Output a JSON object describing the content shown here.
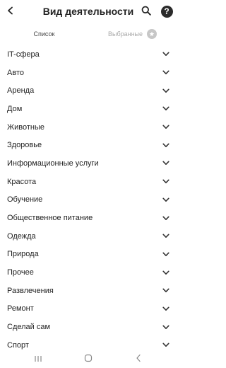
{
  "header": {
    "title": "Вид деятельности",
    "back_icon": "chevron-left-icon",
    "search_icon": "search-icon",
    "help_label": "?"
  },
  "tabs": [
    {
      "label": "Список",
      "active": true
    },
    {
      "label": "Выбранные",
      "active": false,
      "badge_icon": "star-icon"
    }
  ],
  "categories": [
    "IT-сфера",
    "Авто",
    "Аренда",
    "Дом",
    "Животные",
    "Здоровье",
    "Информационные услуги",
    "Красота",
    "Обучение",
    "Общественное питание",
    "Одежда",
    "Природа",
    "Прочее",
    "Развлечения",
    "Ремонт",
    "Сделай сам",
    "Спорт"
  ],
  "navbar": {
    "recents_icon": "recents-icon",
    "home_icon": "home-icon",
    "back_icon": "nav-back-icon"
  },
  "colors": {
    "text": "#222222",
    "muted": "#aaaaaa",
    "badge": "#c7c7c7",
    "help_bg": "#2b2b2b"
  }
}
